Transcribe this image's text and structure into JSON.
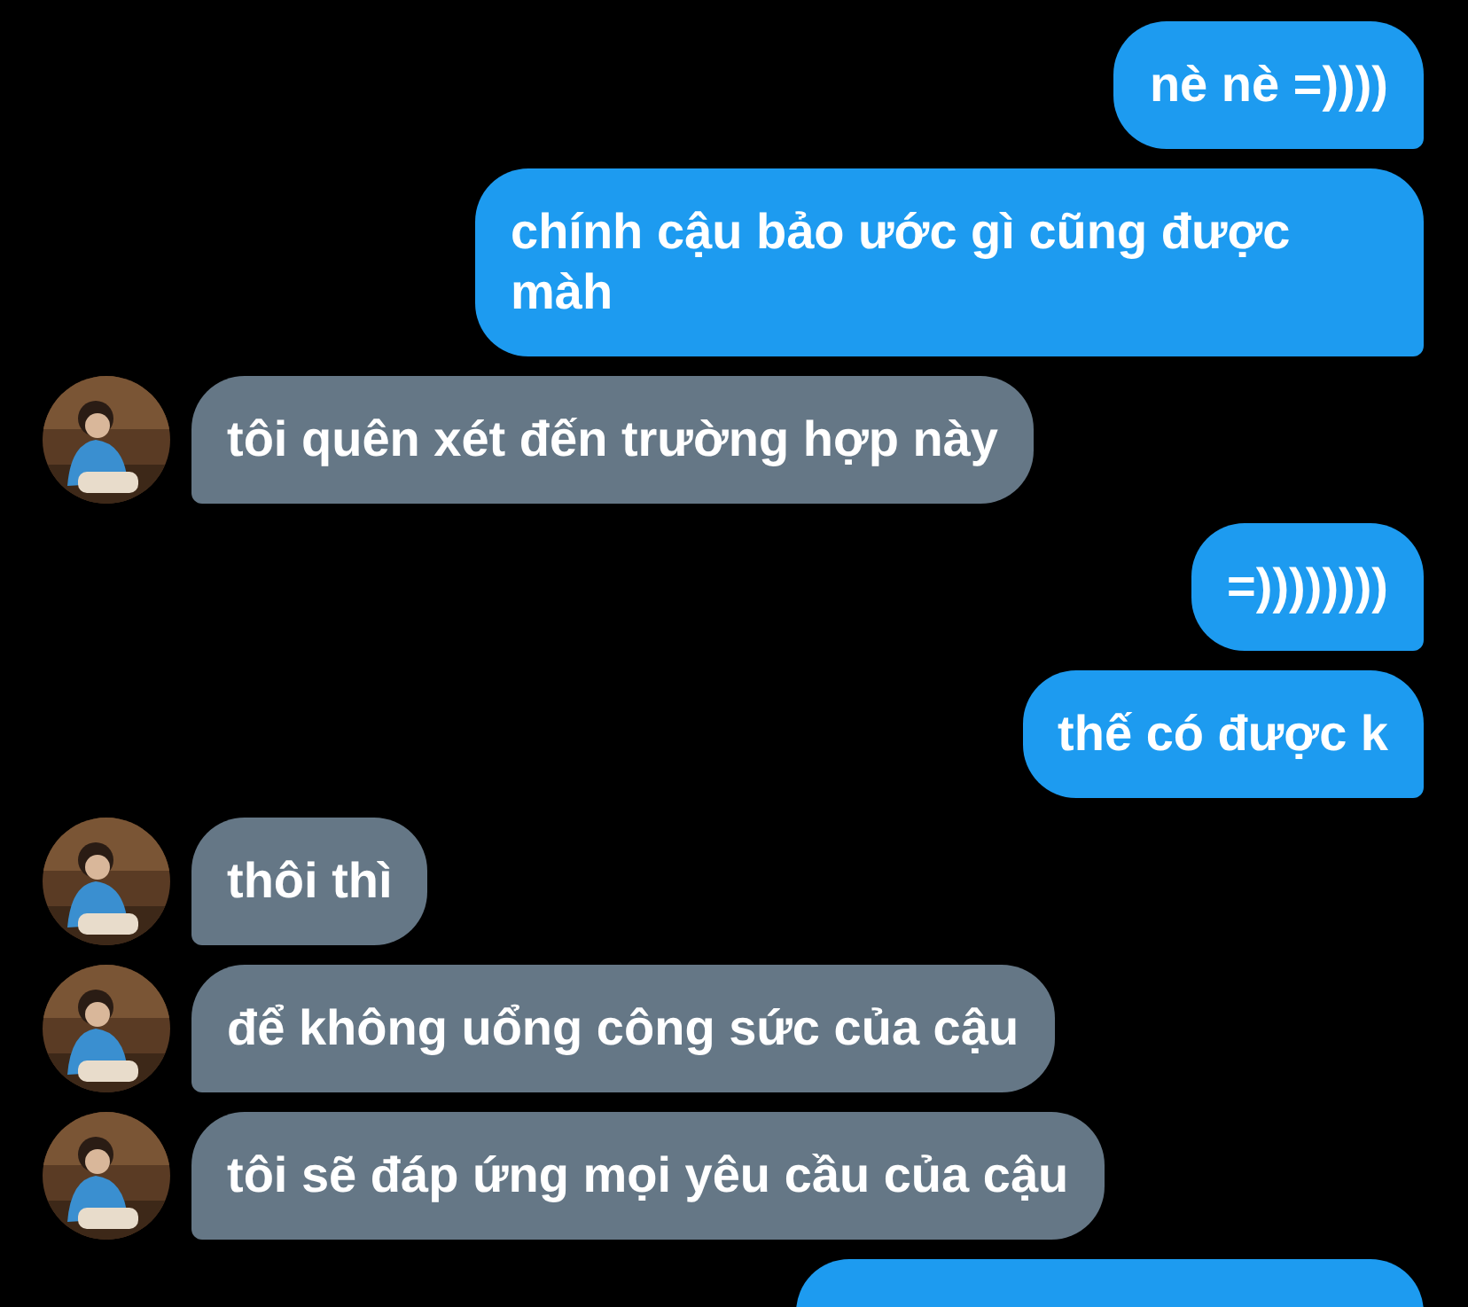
{
  "messages": [
    {
      "kind": "sent",
      "text": "nè nè =))))"
    },
    {
      "kind": "sent",
      "text": "chính cậu bảo ước gì cũng được màh"
    },
    {
      "kind": "received",
      "text": "tôi quên xét đến trường hợp này"
    },
    {
      "kind": "sent",
      "text": "=))))))))"
    },
    {
      "kind": "sent",
      "text": "thế có được k"
    },
    {
      "kind": "received",
      "text": "thôi thì"
    },
    {
      "kind": "received",
      "text": "để không uổng công sức của cậu"
    },
    {
      "kind": "received",
      "text": "tôi sẽ đáp ứng mọi yêu cầu của cậu"
    },
    {
      "kind": "clipped"
    }
  ]
}
